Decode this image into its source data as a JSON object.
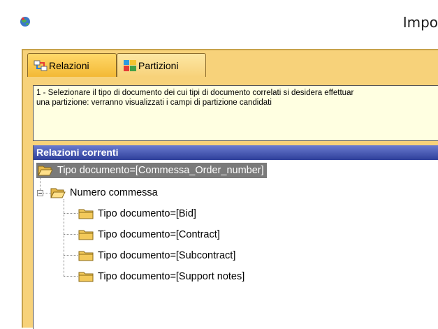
{
  "window": {
    "title": "Impo"
  },
  "tabs": [
    {
      "label": "Relazioni",
      "active": true,
      "icon": "relations-icon"
    },
    {
      "label": "Partizioni",
      "active": false,
      "icon": "partitions-icon"
    }
  ],
  "description": {
    "line1": "1 - Selezionare il tipo di documento dei cui tipi di documento correlati si desidera effettuar",
    "line2": "una partizione: verranno visualizzati i campi di partizione candidati"
  },
  "relations_panel": {
    "header": "Relazioni correnti",
    "root": "Tipo documento=[Commessa_Order_number]",
    "group": "Numero commessa",
    "children": [
      "Tipo documento=[Bid]",
      "Tipo documento=[Contract]",
      "Tipo documento=[Subcontract]",
      "Tipo documento=[Support notes]"
    ]
  },
  "colors": {
    "frame": "#f7d27a",
    "active_tab": "#f3b935",
    "header": "#2e3f9a",
    "selection": "#7a7a7a",
    "description_bg": "#ffffe1"
  }
}
